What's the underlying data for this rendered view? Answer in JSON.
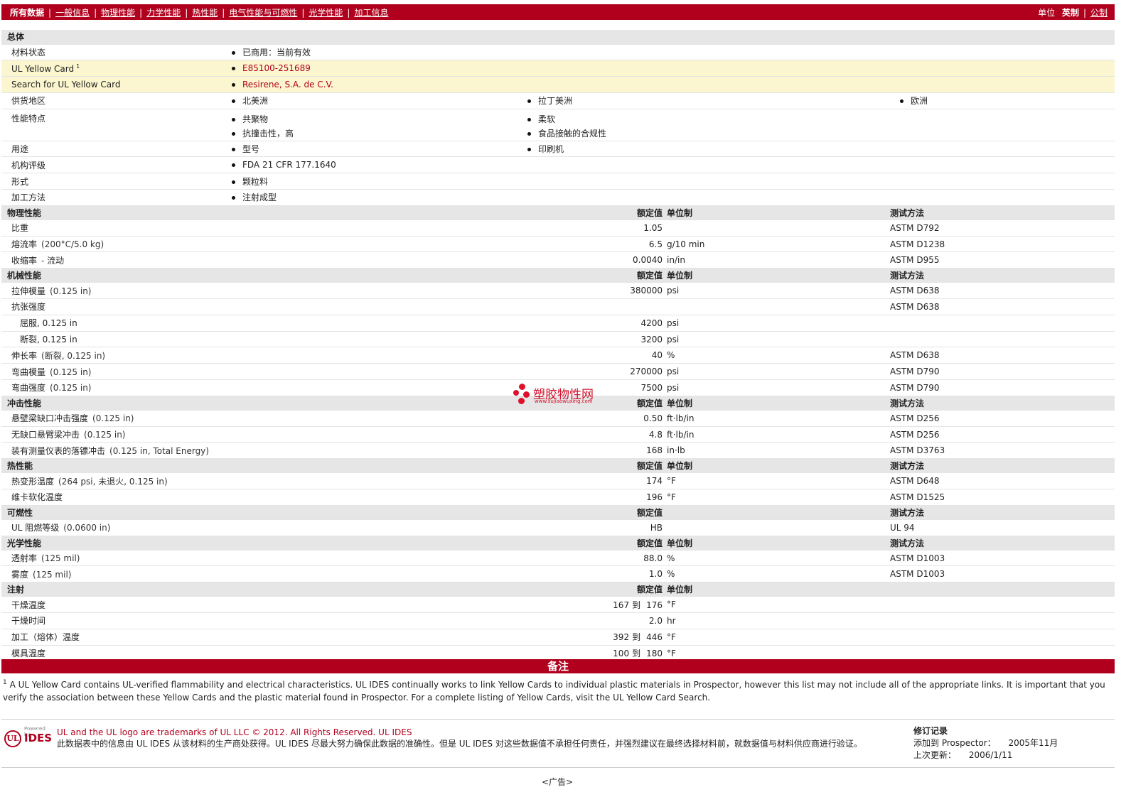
{
  "nav": {
    "current": "所有数据",
    "links": [
      "一般信息",
      "物理性能",
      "力学性能",
      "热性能",
      "电气性能与可燃性",
      "光学性能",
      "加工信息"
    ],
    "units_label": "单位",
    "unit_english": "英制",
    "unit_metric": "公制"
  },
  "general": {
    "title": "总体",
    "rows": {
      "status": {
        "label": "材料状态",
        "value": "已商用：当前有效"
      },
      "ulcard": {
        "label": "UL Yellow Card",
        "sup": "1",
        "value": "E85100-251689"
      },
      "search": {
        "label": "Search for UL Yellow Card",
        "value": "Resirene, S.A. de C.V."
      },
      "region": {
        "label": "供货地区",
        "values": [
          "北美洲",
          "拉丁美洲",
          "欧洲"
        ]
      },
      "features": {
        "label": "性能特点",
        "values": [
          "共聚物",
          "柔软",
          "抗撞击性，高",
          "食品接触的合规性"
        ]
      },
      "uses": {
        "label": "用途",
        "values": [
          "型号",
          "印刷机"
        ]
      },
      "agency": {
        "label": "机构评级",
        "value": "FDA 21 CFR 177.1640"
      },
      "form": {
        "label": "形式",
        "value": "颗粒料"
      },
      "process": {
        "label": "加工方法",
        "value": "注射成型"
      }
    }
  },
  "headers": {
    "nominal": "额定值",
    "unit": "单位制",
    "method": "测试方法"
  },
  "physical": {
    "title": "物理性能",
    "rows": [
      {
        "name": "比重",
        "cond": "",
        "value": "1.05",
        "unit": "",
        "method": "ASTM D792"
      },
      {
        "name": "熔流率",
        "cond": "(200°C/5.0 kg)",
        "value": "6.5",
        "unit": "g/10 min",
        "method": "ASTM D1238"
      },
      {
        "name": "收缩率",
        "cond": "- 流动",
        "value": "0.0040",
        "unit": "in/in",
        "method": "ASTM D955"
      }
    ]
  },
  "mechanical": {
    "title": "机械性能",
    "rows": [
      {
        "name": "拉伸模量",
        "cond": "(0.125 in)",
        "value": "380000",
        "unit": "psi",
        "method": "ASTM D638"
      },
      {
        "name": "抗张强度",
        "cond": "",
        "value": "",
        "unit": "",
        "method": "ASTM D638"
      },
      {
        "name": "屈服, 0.125 in",
        "cond": "",
        "value": "4200",
        "unit": "psi",
        "method": "",
        "sub": true
      },
      {
        "name": "断裂, 0.125 in",
        "cond": "",
        "value": "3200",
        "unit": "psi",
        "method": "",
        "sub": true
      },
      {
        "name": "伸长率",
        "cond": "(断裂, 0.125 in)",
        "value": "40",
        "unit": "%",
        "method": "ASTM D638"
      },
      {
        "name": "弯曲模量",
        "cond": "(0.125 in)",
        "value": "270000",
        "unit": "psi",
        "method": "ASTM D790"
      },
      {
        "name": "弯曲强度",
        "cond": "(0.125 in)",
        "value": "7500",
        "unit": "psi",
        "method": "ASTM D790"
      }
    ]
  },
  "impact": {
    "title": "冲击性能",
    "rows": [
      {
        "name": "悬壁梁缺口冲击强度",
        "cond": "(0.125 in)",
        "value": "0.50",
        "unit": "ft·lb/in",
        "method": "ASTM D256"
      },
      {
        "name": "无缺口悬臂梁冲击",
        "cond": "(0.125 in)",
        "value": "4.8",
        "unit": "ft·lb/in",
        "method": "ASTM D256"
      },
      {
        "name": "装有测量仪表的落镖冲击",
        "cond": "(0.125 in, Total Energy)",
        "value": "168",
        "unit": "in·lb",
        "method": "ASTM D3763"
      }
    ]
  },
  "thermal": {
    "title": "热性能",
    "rows": [
      {
        "name": "热变形温度",
        "cond": "(264 psi, 未退火, 0.125 in)",
        "value": "174",
        "unit": "°F",
        "method": "ASTM D648"
      },
      {
        "name": "维卡软化温度",
        "cond": "",
        "value": "196",
        "unit": "°F",
        "method": "ASTM D1525"
      }
    ]
  },
  "flammability": {
    "title": "可燃性",
    "rows": [
      {
        "name": "UL 阻燃等级",
        "cond": "(0.0600 in)",
        "value": "HB",
        "unit": "",
        "method": "UL 94"
      }
    ]
  },
  "optical": {
    "title": "光学性能",
    "rows": [
      {
        "name": "透射率",
        "cond": "(125 mil)",
        "value": "88.0",
        "unit": "%",
        "method": "ASTM D1003"
      },
      {
        "name": "雾度",
        "cond": "(125 mil)",
        "value": "1.0",
        "unit": "%",
        "method": "ASTM D1003"
      }
    ]
  },
  "injection": {
    "title": "注射",
    "to": "到",
    "rows": [
      {
        "name": "干燥温度",
        "lo": "167",
        "hi": "176",
        "unit": "°F"
      },
      {
        "name": "干燥时间",
        "lo": "",
        "hi": "2.0",
        "unit": "hr"
      },
      {
        "name": "加工（熔体）温度",
        "lo": "392",
        "hi": "446",
        "unit": "°F"
      },
      {
        "name": "模具温度",
        "lo": "100",
        "hi": "180",
        "unit": "°F"
      }
    ]
  },
  "notes": {
    "title": "备注",
    "sup": "1",
    "text": "A UL Yellow Card contains UL-verified flammability and electrical characteristics. UL IDES continually works to link Yellow Cards to individual plastic materials in Prospector, however this list may not include all of the appropriate links. It is important that you verify the association between these Yellow Cards and the plastic material found in Prospector. For a complete listing of Yellow Cards, visit the UL Yellow Card Search."
  },
  "footer": {
    "logo_powered": "Powered by",
    "logo_ul": "UL",
    "logo_ides": "IDES",
    "trademark": "UL and the UL logo are trademarks of UL LLC © 2012. All Rights Reserved. UL IDES",
    "disclaimer": "此数据表中的信息由  UL IDES 从该材料的生产商处获得。UL IDES 尽最大努力确保此数据的准确性。但是  UL IDES 对这些数据值不承担任何责任，并强烈建议在最终选择材料前，就数据值与材料供应商进行验证。",
    "history_title": "修订记录",
    "added_label": "添加到  Prospector：",
    "added_value": "2005年11月",
    "updated_label": "上次更新：",
    "updated_value": "2006/1/11",
    "ad": "<广告>"
  },
  "watermark": {
    "text": "塑胶物性网",
    "url": "www.sujiaowuxing.com"
  },
  "colors": {
    "brand": "#b0001e",
    "section_bg": "#e6e6e6",
    "highlight": "#fbf6cf"
  }
}
